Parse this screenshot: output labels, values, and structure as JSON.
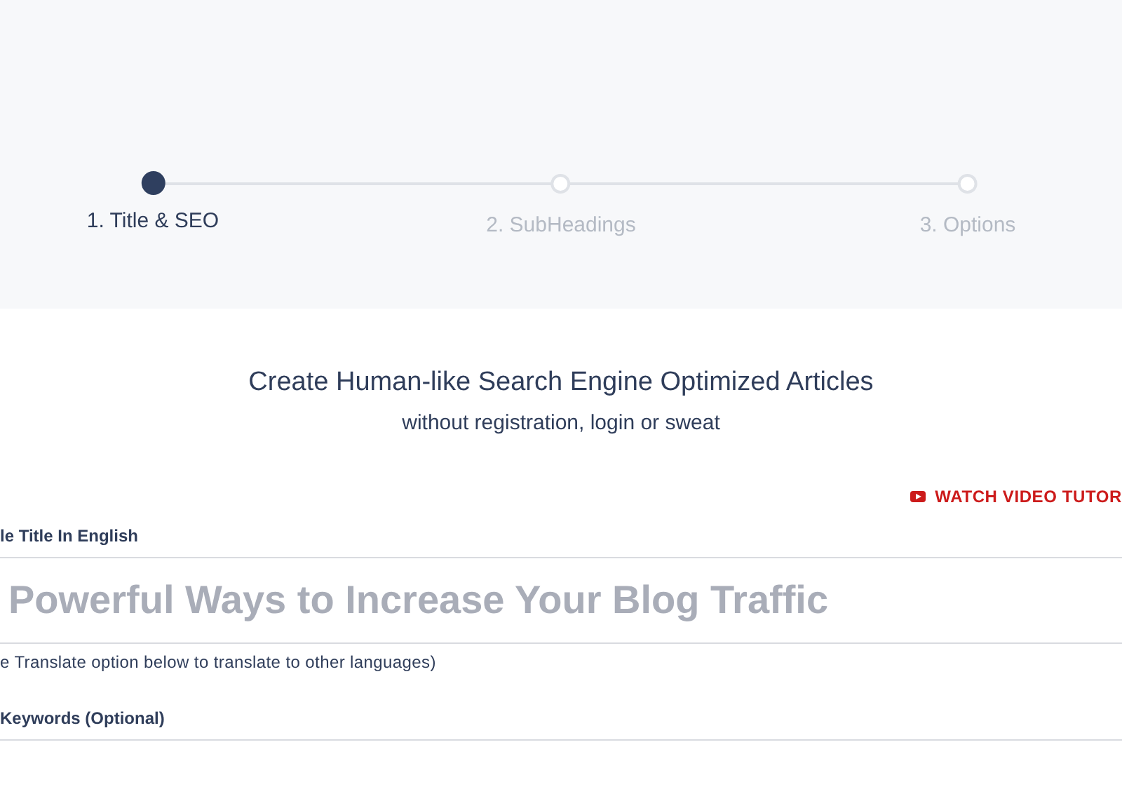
{
  "stepper": {
    "steps": [
      {
        "label": "1. Title & SEO",
        "selected": true
      },
      {
        "label": "2. SubHeadings",
        "selected": false
      },
      {
        "label": "3. Options",
        "selected": false
      }
    ]
  },
  "intro": {
    "heading": "Create Human-like Search Engine Optimized Articles",
    "subheading": "without registration, login or sweat"
  },
  "video_link": "WATCH VIDEO TUTOR",
  "title_field": {
    "label": "le Title In English",
    "placeholder": "Powerful Ways to Increase Your Blog Traffic",
    "hint": "e Translate option below to translate to other languages)"
  },
  "keywords_field": {
    "label": "Keywords (Optional)"
  }
}
